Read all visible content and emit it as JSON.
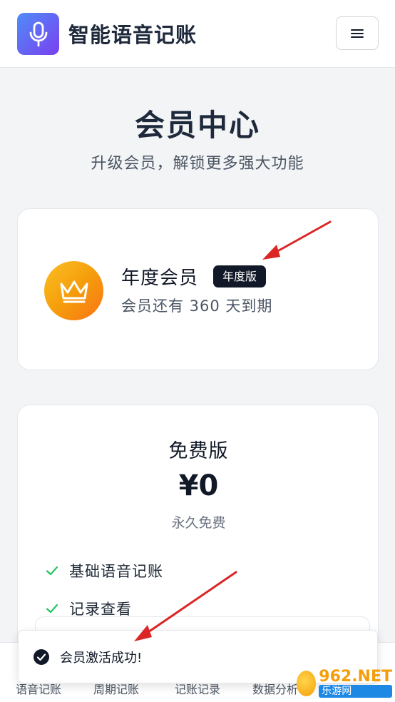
{
  "header": {
    "app_title": "智能语音记账",
    "logo_icon": "microphone-icon",
    "menu_icon": "hamburger-menu-icon"
  },
  "page": {
    "title": "会员中心",
    "subtitle": "升级会员，解锁更多强大功能"
  },
  "membership": {
    "name": "年度会员",
    "badge": "年度版",
    "expiry": "会员还有 360 天到期",
    "icon": "crown-icon"
  },
  "plan": {
    "name": "免费版",
    "price": "¥0",
    "period": "永久免费",
    "features": [
      "基础语音记账",
      "记录查看"
    ]
  },
  "bottom_nav": {
    "items": [
      "语音记账",
      "周期记账",
      "记账记录",
      "数据分析"
    ]
  },
  "toast": {
    "message": "会员激活成功!"
  },
  "watermark": {
    "brand": "962.NET",
    "sub": "乐游网"
  },
  "colors": {
    "accent_gradient_start": "#4f8df7",
    "accent_gradient_end": "#7a3ff0",
    "crown_gold": "#f59e0b",
    "check_green": "#22c55e",
    "annotation_red": "#dc2626"
  }
}
